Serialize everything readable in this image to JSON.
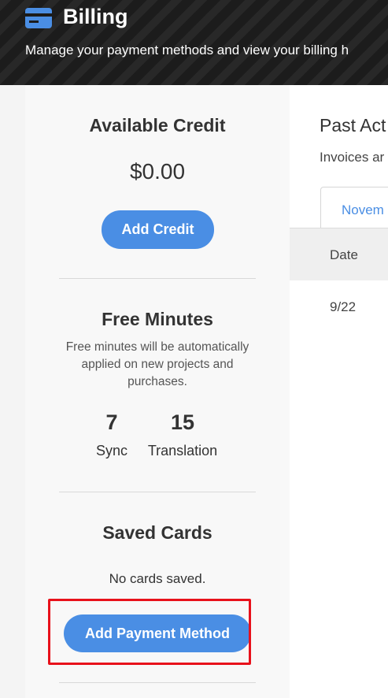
{
  "header": {
    "title": "Billing",
    "subtitle": "Manage your payment methods and view your billing h",
    "icon": "credit-card-icon"
  },
  "left_panel": {
    "available_credit": {
      "title": "Available Credit",
      "amount": "$0.00",
      "button_label": "Add Credit"
    },
    "free_minutes": {
      "title": "Free Minutes",
      "description": "Free minutes will be automatically applied on new projects and purchases.",
      "stats": [
        {
          "value": "7",
          "label": "Sync"
        },
        {
          "value": "15",
          "label": "Translation"
        }
      ]
    },
    "saved_cards": {
      "title": "Saved Cards",
      "empty_text": "No cards saved.",
      "button_label": "Add Payment Method"
    }
  },
  "right_panel": {
    "title": "Past Act",
    "subtitle": "Invoices ar",
    "tab_label": "Novem",
    "table": {
      "columns": [
        "Date"
      ],
      "rows": [
        [
          "9/22"
        ]
      ]
    }
  },
  "colors": {
    "accent": "#4a8ee4",
    "header_bg": "#1c1c1c",
    "highlight": "#e8111b"
  }
}
